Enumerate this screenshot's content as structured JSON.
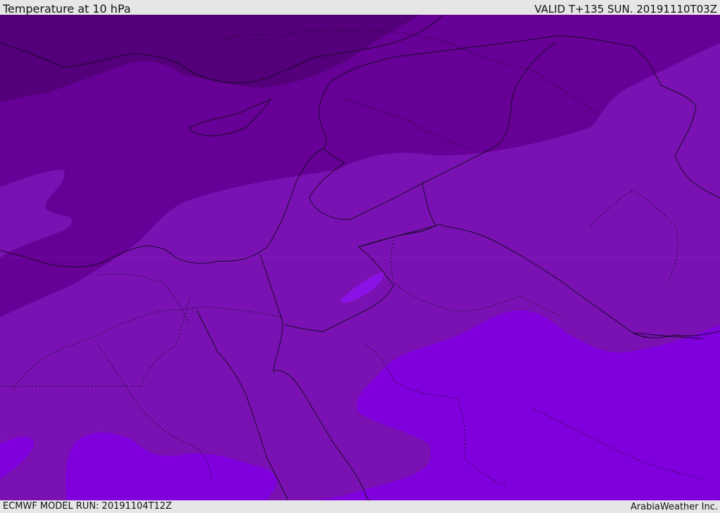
{
  "header": {
    "title": "Temperature at 10 hPa",
    "valid_time": "VALID T+135 SUN. 20191110T03Z"
  },
  "footer": {
    "model_run": "ECMWF MODEL RUN: 20191104T12Z",
    "credit": "ArabiaWeather Inc."
  },
  "map": {
    "field": "temperature",
    "level": "10 hPa",
    "colors": {
      "coldest": "#53007a",
      "cold": "#670096",
      "mid": "#7a12b3",
      "warm": "#8000dd",
      "band": "#8a12e6"
    }
  }
}
